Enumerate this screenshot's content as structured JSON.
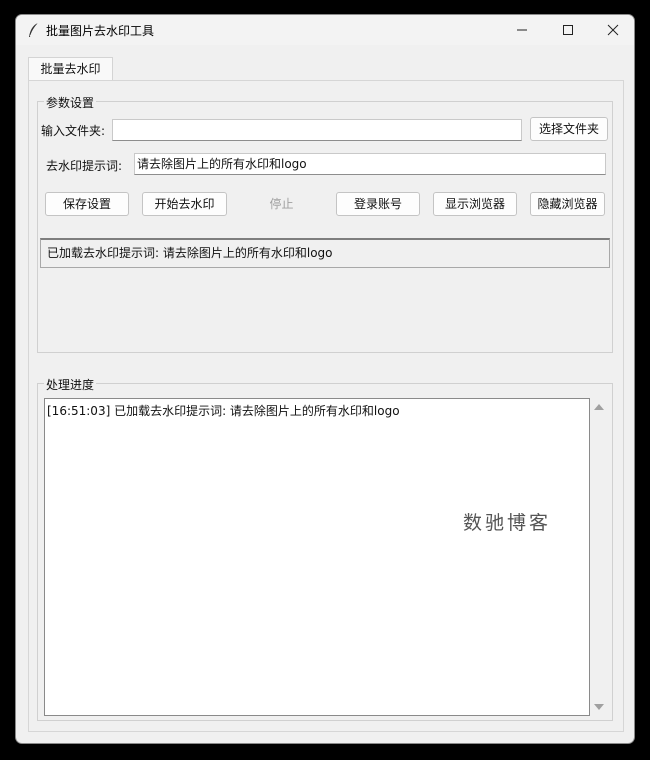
{
  "window": {
    "title": "批量图片去水印工具",
    "icon": "feather-icon"
  },
  "tabs": [
    {
      "label": "批量去水印",
      "active": true
    }
  ],
  "params": {
    "legend": "参数设置",
    "input_folder_label": "输入文件夹:",
    "input_folder_value": "",
    "choose_folder_button": "选择文件夹",
    "prompt_label": "去水印提示词:",
    "prompt_value": "请去除图片上的所有水印和logo",
    "buttons": {
      "save": "保存设置",
      "start": "开始去水印",
      "stop": "停止",
      "login": "登录账号",
      "show_browser": "显示浏览器",
      "hide_browser": "隐藏浏览器"
    },
    "status": "已加载去水印提示词: 请去除图片上的所有水印和logo"
  },
  "progress": {
    "legend": "处理进度",
    "log_lines": [
      "[16:51:03] 已加载去水印提示词: 请去除图片上的所有水印和logo"
    ]
  },
  "watermark_text": "数驰博客"
}
